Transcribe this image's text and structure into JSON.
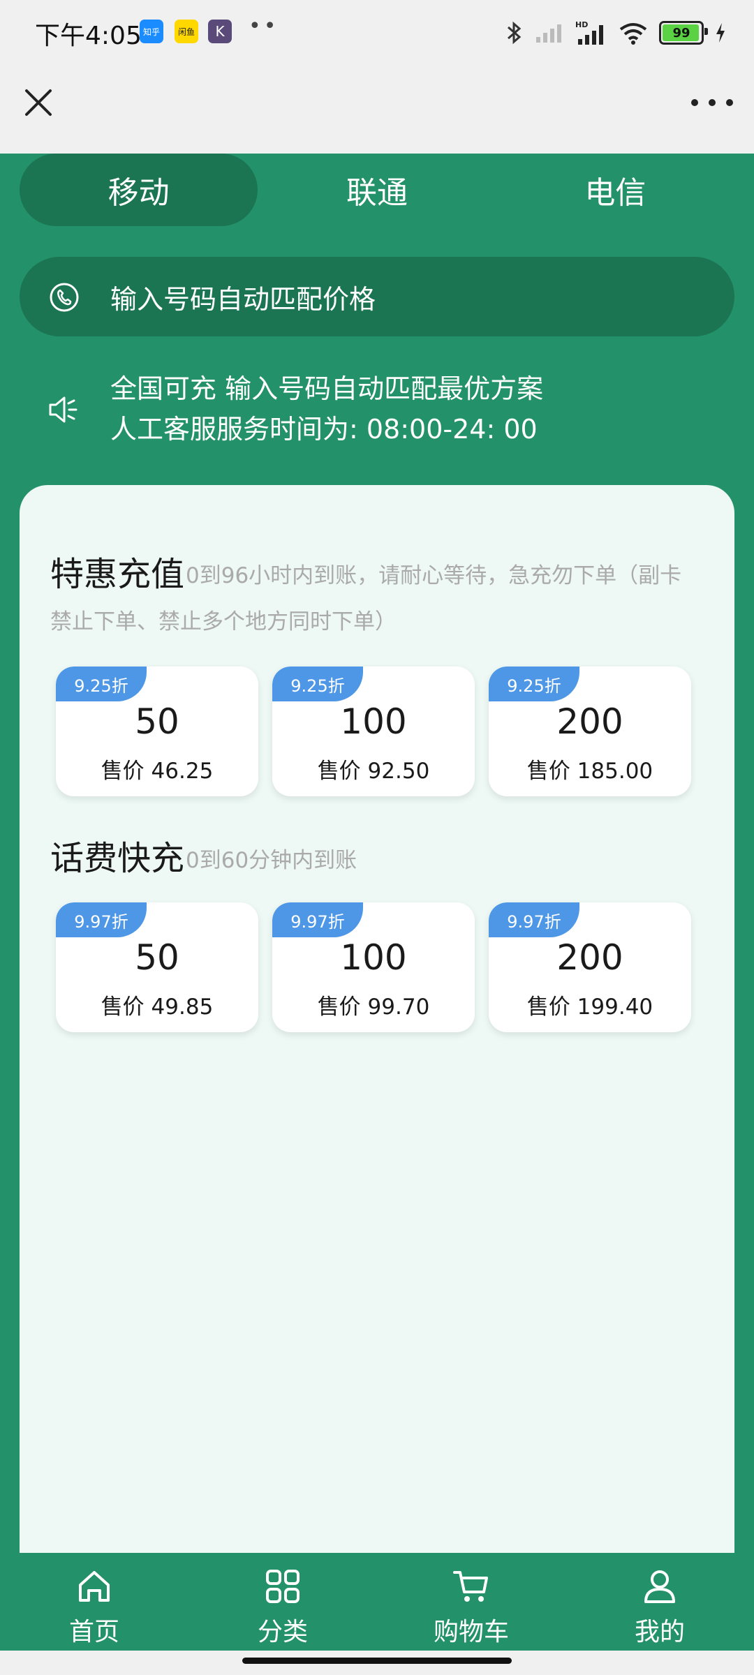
{
  "status_bar": {
    "time": "下午4:05",
    "app_badges": [
      "知乎",
      "闲鱼",
      "K"
    ],
    "battery": "99"
  },
  "carrier_tabs": [
    {
      "label": "移动",
      "active": true
    },
    {
      "label": "联通",
      "active": false
    },
    {
      "label": "电信",
      "active": false
    }
  ],
  "phone_input": {
    "placeholder": "输入号码自动匹配价格"
  },
  "notice": {
    "line1": "全国可充 输入号码自动匹配最优方案",
    "line2": "人工客服服务时间为: 08:00-24: 00"
  },
  "sections": [
    {
      "title": "特惠充值",
      "desc_line1": "0到96小时内到账，请耐心等待，急充勿下单（副卡",
      "desc_line2": "禁止下单、禁止多个地方同时下单）",
      "products": [
        {
          "discount": "9.25折",
          "face_value": "50",
          "price": "售价 46.25"
        },
        {
          "discount": "9.25折",
          "face_value": "100",
          "price": "售价 92.50"
        },
        {
          "discount": "9.25折",
          "face_value": "200",
          "price": "售价 185.00"
        }
      ]
    },
    {
      "title": "话费快充",
      "desc": "0到60分钟内到账",
      "products": [
        {
          "discount": "9.97折",
          "face_value": "50",
          "price": "售价 49.85"
        },
        {
          "discount": "9.97折",
          "face_value": "100",
          "price": "售价 99.70"
        },
        {
          "discount": "9.97折",
          "face_value": "200",
          "price": "售价 199.40"
        }
      ]
    }
  ],
  "tab_bar": [
    {
      "label": "首页",
      "icon": "home-icon"
    },
    {
      "label": "分类",
      "icon": "grid-icon"
    },
    {
      "label": "购物车",
      "icon": "cart-icon"
    },
    {
      "label": "我的",
      "icon": "user-icon"
    }
  ],
  "colors": {
    "primary_green": "#23916a",
    "dark_green": "#1c7552",
    "card_bg": "#eef9f5",
    "discount_blue": "#4d97e6"
  }
}
